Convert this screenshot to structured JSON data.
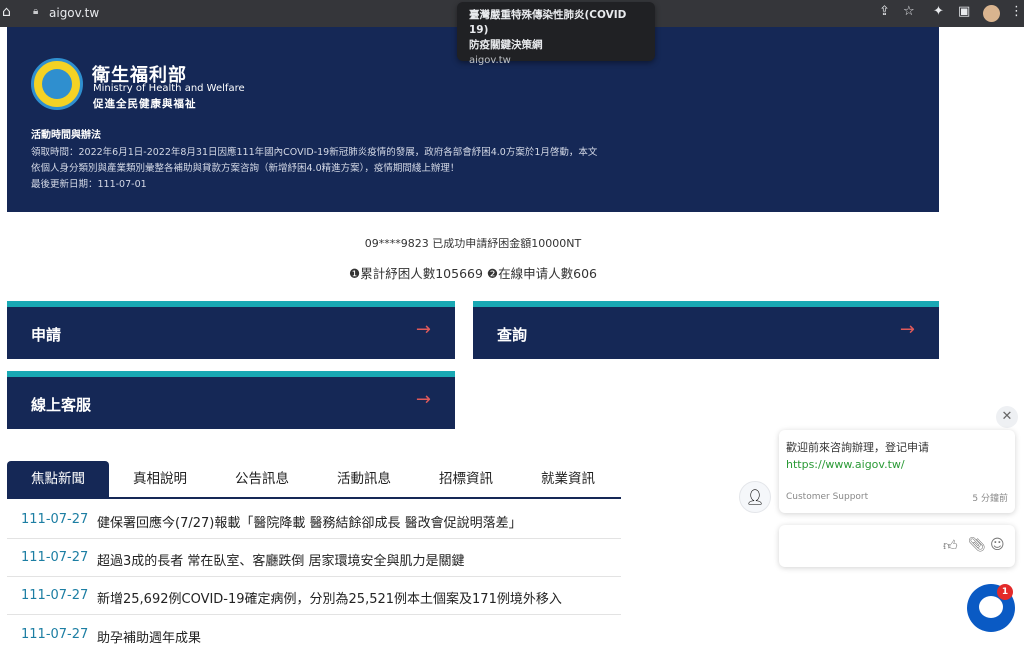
{
  "browser": {
    "url": "aigov.tw",
    "tooltip": {
      "title_line1": "臺灣嚴重特殊傳染性肺炎(COVID 19)",
      "title_line2": "防疫關鍵決策網",
      "url": "aigov.tw"
    }
  },
  "banner": {
    "ministry_cn": "衛生福利部",
    "ministry_en": "Ministry of Health and Welfare",
    "slogan": "促進全民健康與福祉",
    "activity_title": "活動時間與辦法",
    "activity_line1": "領取時間：2022年6月1日-2022年8月31日因應111年國內COVID-19新冠肺炎疫情的發展，政府各部會紓困4.0方案於1月啓動，本文",
    "activity_line2": "依個人身分類別與產業類別彙整各補助與貸款方案咨詢（新增紓困4.0精進方案），疫情期間綫上辦理！",
    "updated": "最後更新日期：111-07-01"
  },
  "ticker": "09****9823 已成功申請紓困金額10000NT",
  "stats": "❶累計紓困人數105669 ❷在線申请人數606",
  "cards": {
    "apply": "申請",
    "query": "查詢",
    "service": "線上客服"
  },
  "tabs": [
    "焦點新聞",
    "真相說明",
    "公告訊息",
    "活動訊息",
    "招標資訊",
    "就業資訊"
  ],
  "news": [
    {
      "date": "111-07-27",
      "title": "健保署回應今(7/27)報載「醫院降載 醫務結餘卻成長 醫改會促說明落差」"
    },
    {
      "date": "111-07-27",
      "title": "超過3成的長者 常在臥室、客廳跌倒 居家環境安全與肌力是關鍵"
    },
    {
      "date": "111-07-27",
      "title": "新增25,692例COVID-19確定病例，分別為25,521例本土個案及171例境外移入"
    },
    {
      "date": "111-07-27",
      "title": "助孕補助週年成果"
    }
  ],
  "chat": {
    "message": "歡迎前來咨詢辦理，登记申请",
    "link": "https://www.aigov.tw/",
    "agent": "Customer Support",
    "time": "5 分鐘前",
    "unread": "1"
  }
}
